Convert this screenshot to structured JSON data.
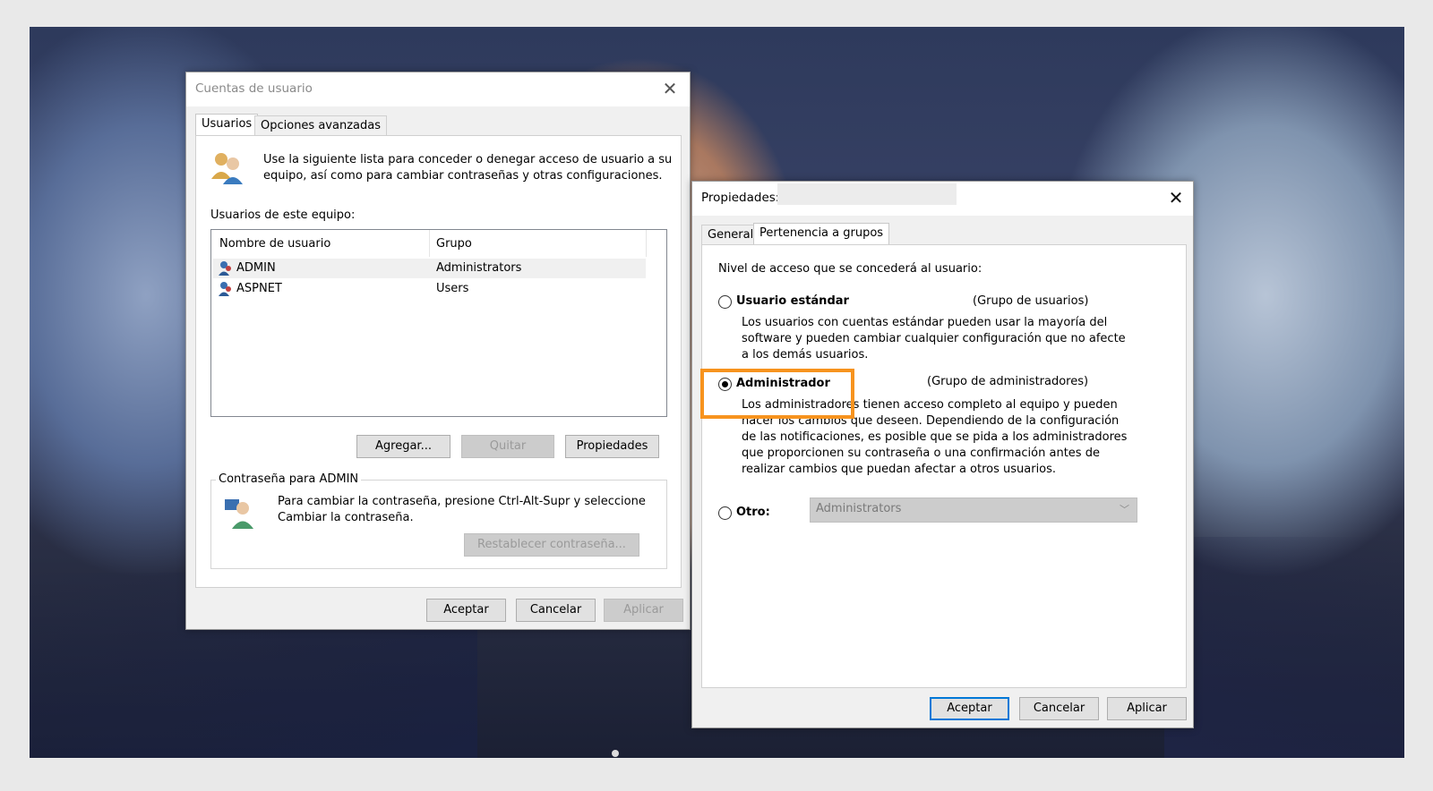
{
  "users_dialog": {
    "title": "Cuentas de usuario",
    "tabs": [
      "Usuarios",
      "Opciones avanzadas"
    ],
    "intro_text_line1": "Use la siguiente lista para conceder o denegar acceso de usuario a su",
    "intro_text_line2": "equipo, así como para cambiar contraseñas y otras configuraciones.",
    "list_label": "Usuarios de este equipo:",
    "columns": [
      "Nombre de usuario",
      "Grupo"
    ],
    "rows": [
      {
        "name": "ADMIN",
        "group": "Administrators"
      },
      {
        "name": "ASPNET",
        "group": "Users"
      }
    ],
    "btn_add": "Agregar...",
    "btn_remove": "Quitar",
    "btn_properties": "Propiedades",
    "password_group_label": "Contraseña para ADMIN",
    "password_text_line1": "Para cambiar la contraseña, presione Ctrl-Alt-Supr y seleccione",
    "password_text_line2": "Cambiar la contraseña.",
    "btn_reset_password": "Restablecer contraseña...",
    "btn_ok": "Aceptar",
    "btn_cancel": "Cancelar",
    "btn_apply": "Aplicar"
  },
  "props_dialog": {
    "title": "Propiedades:",
    "tabs": [
      "General",
      "Pertenencia a grupos"
    ],
    "access_label": "Nivel de acceso que se concederá al usuario:",
    "standard_label": "Usuario estándar",
    "standard_group": "(Grupo de usuarios)",
    "standard_desc": [
      "Los usuarios con cuentas estándar pueden usar la mayoría del",
      "software y pueden cambiar cualquier configuración que no afecte",
      "a los demás usuarios."
    ],
    "admin_label": "Administrador",
    "admin_group": "(Grupo de administradores)",
    "admin_desc": [
      "Los administradores tienen acceso completo al equipo y pueden",
      "hacer los cambios que deseen. Dependiendo de la configuración",
      "de las notificaciones, es posible que se pida a los administradores",
      "que proporcionen su contraseña o una confirmación antes de",
      "realizar cambios que puedan afectar a otros usuarios."
    ],
    "other_label": "Otro:",
    "other_value": "Administrators",
    "btn_ok": "Aceptar",
    "btn_cancel": "Cancelar",
    "btn_apply": "Aplicar"
  },
  "colors": {
    "highlight": "#f7931e",
    "default_button_border": "#0078d7"
  }
}
